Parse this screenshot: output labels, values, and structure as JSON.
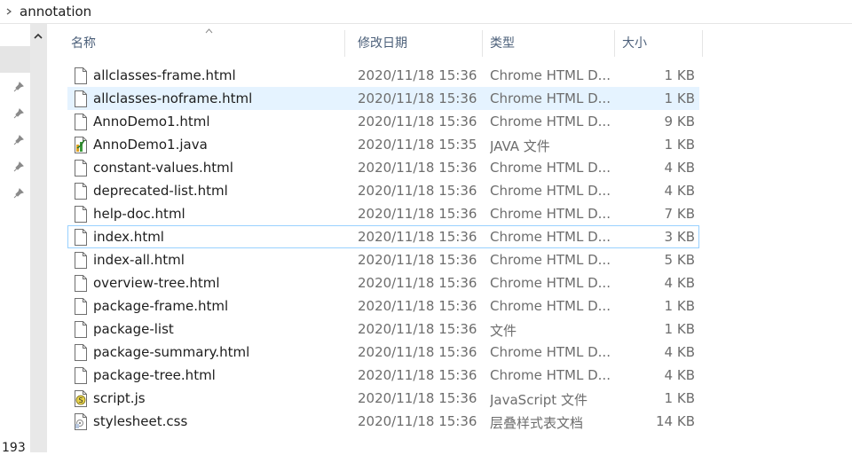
{
  "breadcrumb": {
    "folder": "annotation"
  },
  "nav": {
    "line_number": "193"
  },
  "columns": {
    "name": "名称",
    "date": "修改日期",
    "type": "类型",
    "size": "大小"
  },
  "files": [
    {
      "name": "allclasses-frame.html",
      "date": "2020/11/18 15:36",
      "type": "Chrome HTML D...",
      "size": "1 KB",
      "icon": "html-file-icon"
    },
    {
      "name": "allclasses-noframe.html",
      "date": "2020/11/18 15:36",
      "type": "Chrome HTML D...",
      "size": "1 KB",
      "icon": "html-file-icon"
    },
    {
      "name": "AnnoDemo1.html",
      "date": "2020/11/18 15:36",
      "type": "Chrome HTML D...",
      "size": "9 KB",
      "icon": "html-file-icon"
    },
    {
      "name": "AnnoDemo1.java",
      "date": "2020/11/18 15:35",
      "type": "JAVA 文件",
      "size": "1 KB",
      "icon": "java-file-icon"
    },
    {
      "name": "constant-values.html",
      "date": "2020/11/18 15:36",
      "type": "Chrome HTML D...",
      "size": "4 KB",
      "icon": "html-file-icon"
    },
    {
      "name": "deprecated-list.html",
      "date": "2020/11/18 15:36",
      "type": "Chrome HTML D...",
      "size": "4 KB",
      "icon": "html-file-icon"
    },
    {
      "name": "help-doc.html",
      "date": "2020/11/18 15:36",
      "type": "Chrome HTML D...",
      "size": "7 KB",
      "icon": "html-file-icon"
    },
    {
      "name": "index.html",
      "date": "2020/11/18 15:36",
      "type": "Chrome HTML D...",
      "size": "3 KB",
      "icon": "html-file-icon"
    },
    {
      "name": "index-all.html",
      "date": "2020/11/18 15:36",
      "type": "Chrome HTML D...",
      "size": "5 KB",
      "icon": "html-file-icon"
    },
    {
      "name": "overview-tree.html",
      "date": "2020/11/18 15:36",
      "type": "Chrome HTML D...",
      "size": "4 KB",
      "icon": "html-file-icon"
    },
    {
      "name": "package-frame.html",
      "date": "2020/11/18 15:36",
      "type": "Chrome HTML D...",
      "size": "1 KB",
      "icon": "html-file-icon"
    },
    {
      "name": "package-list",
      "date": "2020/11/18 15:36",
      "type": "文件",
      "size": "1 KB",
      "icon": "file-icon"
    },
    {
      "name": "package-summary.html",
      "date": "2020/11/18 15:36",
      "type": "Chrome HTML D...",
      "size": "4 KB",
      "icon": "html-file-icon"
    },
    {
      "name": "package-tree.html",
      "date": "2020/11/18 15:36",
      "type": "Chrome HTML D...",
      "size": "4 KB",
      "icon": "html-file-icon"
    },
    {
      "name": "script.js",
      "date": "2020/11/18 15:36",
      "type": "JavaScript 文件",
      "size": "1 KB",
      "icon": "js-file-icon"
    },
    {
      "name": "stylesheet.css",
      "date": "2020/11/18 15:36",
      "type": "层叠样式表文档",
      "size": "14 KB",
      "icon": "css-file-icon"
    }
  ],
  "state": {
    "hovered_index": 1,
    "focused_index": 7
  },
  "colors": {
    "hover": "#e5f3ff",
    "focus_border": "#99d1ff",
    "header_text": "#4c607a",
    "meta_text": "#6d6d6d"
  }
}
